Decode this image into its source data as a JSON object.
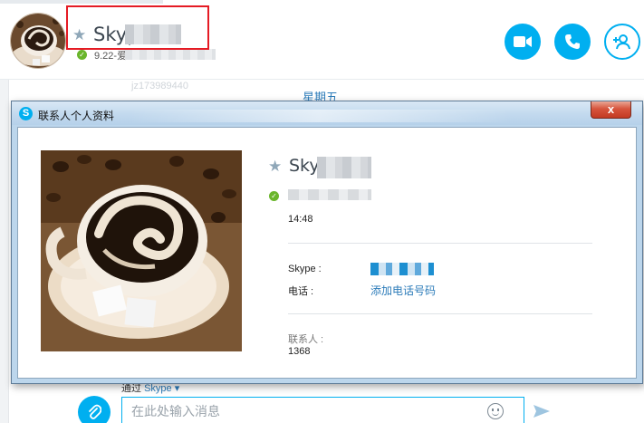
{
  "header": {
    "name_visible": "Skyp",
    "mood_visible": "9.22-爱",
    "faint_id": "jz173989440"
  },
  "conversation": {
    "day_label": "星期五"
  },
  "composer": {
    "via_prefix": "通过",
    "via_service": "Skype",
    "via_caret": "▾",
    "placeholder": "在此处输入消息"
  },
  "dialog": {
    "title": "联系人个人资料",
    "close_glyph": "x",
    "name_visible": "Sky",
    "local_time": "14:48",
    "skype_label": "Skype :",
    "phone_label": "电话 :",
    "add_phone_link": "添加电话号码",
    "contacts_label": "联系人 :",
    "contacts_count": "1368"
  },
  "icons": {
    "star": "favorite-star-icon",
    "status": "online-status-icon",
    "video": "video-call-icon",
    "call": "phone-call-icon",
    "add_contact": "add-contact-icon",
    "attach": "paperclip-icon",
    "emoji": "emoji-icon",
    "send": "send-icon",
    "skype_logo": "skype-logo-icon"
  },
  "colors": {
    "accent": "#00aff0",
    "link": "#2b7bb9",
    "online": "#6ab62c",
    "highlight_box": "#e51b24",
    "close_button": "#c94a33"
  }
}
